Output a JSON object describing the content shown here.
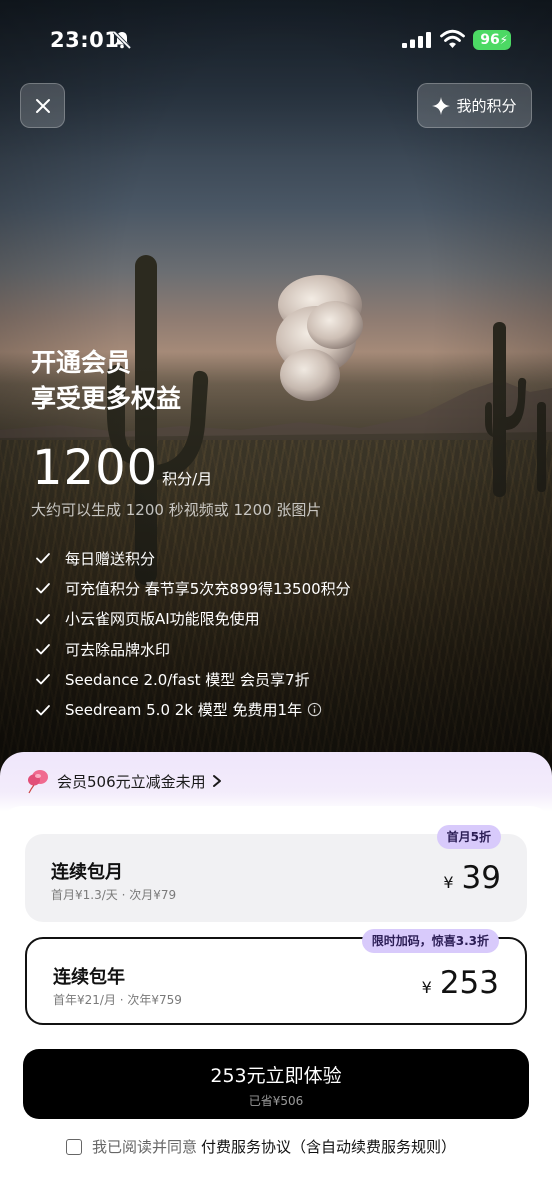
{
  "status_bar": {
    "time": "23:01",
    "battery": "96"
  },
  "header": {
    "points_label": "我的积分"
  },
  "hero": {
    "headline_line1": "开通会员",
    "headline_line2": "享受更多权益",
    "amount": "1200",
    "amount_unit": "积分/月",
    "description": "大约可以生成 1200 秒视频或 1200 张图片",
    "benefits": [
      "每日赠送积分",
      "可充值积分 春节享5次充899得13500积分",
      "小云雀网页版AI功能限免使用",
      "可去除品牌水印",
      "Seedance 2.0/fast 模型 会员享7折",
      "Seedream 5.0 2k 模型 免费用1年"
    ]
  },
  "sheet": {
    "coupon_text": "会员506元立减金未用",
    "plans": [
      {
        "name": "连续包月",
        "sub": "首月¥1.3/天 · 次月¥79",
        "currency": "¥",
        "price": "39",
        "tag": "首月5折"
      },
      {
        "name": "连续包年",
        "sub": "首年¥21/月 · 次年¥759",
        "currency": "¥",
        "price": "253",
        "tag": "限时加码，惊喜3.3折"
      }
    ],
    "cta_label": "253元立即体验",
    "cta_saved": "已省¥506",
    "agree_prefix": "我已阅读并同意",
    "agree_link": "付费服务协议（含自动续费服务规则）"
  },
  "colors": {
    "accent_tag": "#d8cafb",
    "battery": "#4cd964",
    "cta": "#000000"
  },
  "icons": [
    "bell-slash-icon",
    "signal-icon",
    "wifi-icon",
    "close-icon",
    "sparkle-icon",
    "check-icon",
    "info-icon",
    "balloon-icon",
    "chevron-right-icon"
  ]
}
